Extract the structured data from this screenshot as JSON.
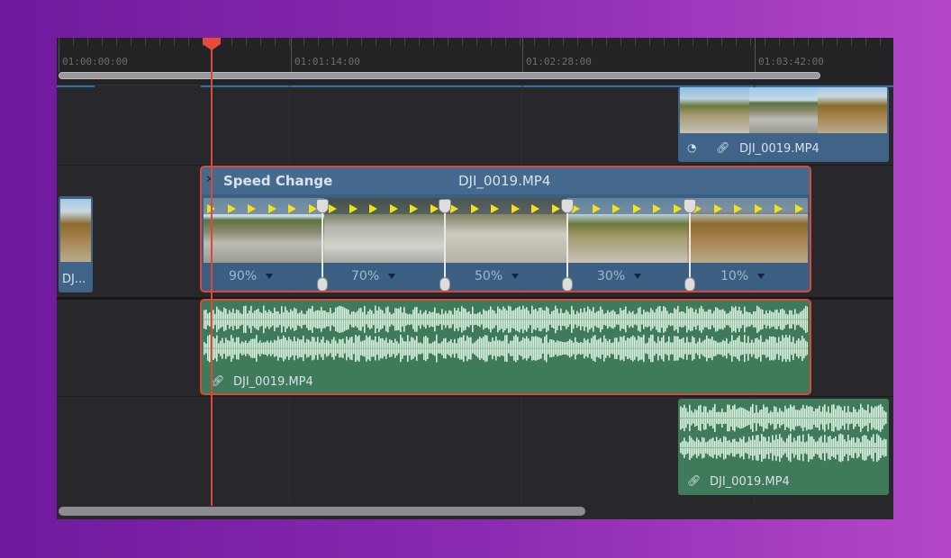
{
  "ruler": {
    "timecodes": [
      "01:00:00:00",
      "01:01:14:00",
      "01:02:28:00",
      "01:03:42:00"
    ]
  },
  "clips": {
    "top_video": {
      "name": "DJI_0019.MP4",
      "icons": [
        "speed-gauge-icon",
        "link-icon"
      ]
    },
    "left_video": {
      "name": "DJ..."
    },
    "speed_clip": {
      "title": "Speed Change",
      "name": "DJI_0019.MP4",
      "speeds": [
        "90%",
        "70%",
        "50%",
        "30%",
        "10%"
      ]
    },
    "audio_main": {
      "name": "DJI_0019.MP4"
    },
    "audio_right": {
      "name": "DJI_0019.MP4"
    }
  },
  "colors": {
    "selection": "#d94a3a",
    "video_clip": "#3f6487",
    "audio_clip": "#3f7a5a",
    "playhead": "#e54b3c"
  }
}
